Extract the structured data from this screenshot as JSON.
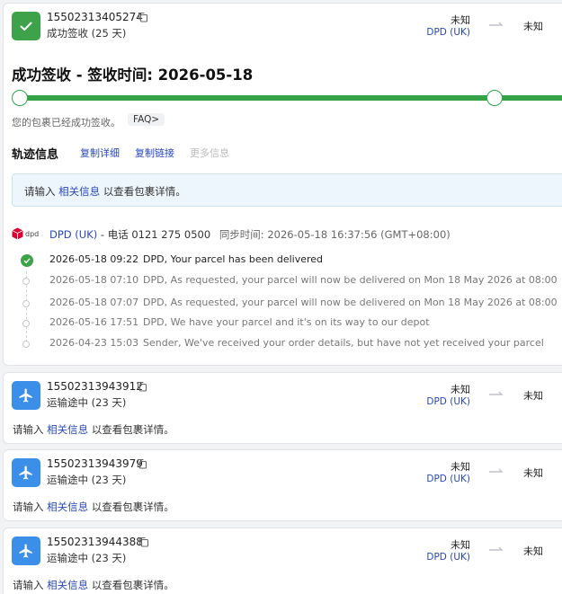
{
  "shipments": [
    {
      "tracking_number": "15502313405274",
      "status": "成功签收 (25 天)",
      "origin": "未知",
      "carrier": "DPD (UK)",
      "destination": "未知",
      "detail": {
        "title": "成功签收 - 签收时间: 2026-05-18",
        "note": "您的包裹已经成功签收。",
        "faq_label": "FAQ>",
        "tabs_heading": "轨迹信息",
        "copy_detail_label": "复制详细",
        "copy_link_label": "复制链接",
        "more_info_label": "更多信息",
        "info_prompt_before": "请输入",
        "info_prompt_link": "相关信息",
        "info_prompt_after": "以查看包裹详情。",
        "carrier_logo_text": "dpd",
        "carrier_name": "DPD (UK)",
        "carrier_phone": "- 电话 0121 275 0500",
        "sync_time": "同步时间: 2026-05-18 16:37:56 (GMT+08:00)",
        "events": [
          {
            "time": "2026-05-18 09:22",
            "desc": "DPD, Your parcel has been delivered"
          },
          {
            "time": "2026-05-18 07:10",
            "desc": "DPD, As requested, your parcel will now be delivered on Mon 18 May 2026 at 08:00"
          },
          {
            "time": "2026-05-18 07:07",
            "desc": "DPD, As requested, your parcel will now be delivered on Mon 18 May 2026 at 08:00"
          },
          {
            "time": "2026-05-16 17:51",
            "desc": "DPD, We have your parcel and it's on its way to our depot"
          },
          {
            "time": "2026-04-23 15:03",
            "desc": "Sender, We've received your order details, but have not yet received your parcel"
          }
        ]
      }
    },
    {
      "tracking_number": "15502313943912",
      "status": "运输途中 (23 天)",
      "origin": "未知",
      "carrier": "DPD (UK)",
      "destination": "未知",
      "prompt_before": "请输入",
      "prompt_link": "相关信息",
      "prompt_after": "以查看包裹详情。"
    },
    {
      "tracking_number": "15502313943979",
      "status": "运输途中 (23 天)",
      "origin": "未知",
      "carrier": "DPD (UK)",
      "destination": "未知",
      "prompt_before": "请输入",
      "prompt_link": "相关信息",
      "prompt_after": "以查看包裹详情。"
    },
    {
      "tracking_number": "15502313944388",
      "status": "运输途中 (23 天)",
      "origin": "未知",
      "carrier": "DPD (UK)",
      "destination": "未知",
      "prompt_before": "请输入",
      "prompt_link": "相关信息",
      "prompt_after": "以查看包裹详情。"
    }
  ],
  "colors": {
    "delivered_green": "#3da24a",
    "transit_blue": "#3b8fe8",
    "link_blue": "#2747b8",
    "dpd_red": "#dc0032"
  },
  "icons": [
    "check-icon",
    "copy-icon",
    "arrow-icon",
    "plane-icon",
    "dpd-logo"
  ]
}
